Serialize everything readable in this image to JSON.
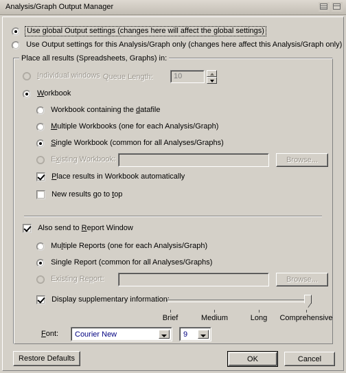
{
  "window": {
    "title": "Analysis/Graph Output Manager",
    "titlebar_buttons": [
      {
        "name": "tile-windows-icon",
        "icon": "tile-icon"
      },
      {
        "name": "cascade-windows-icon",
        "icon": "cascade-icon"
      }
    ]
  },
  "scope": {
    "global_option": "Use global Output settings (changes here will affect the global settings)",
    "local_option": "Use Output settings for this Analysis/Graph only (changes here affect this Analysis/Graph only)",
    "selected": "global"
  },
  "place_group": {
    "title": "Place all results (Spreadsheets, Graphs) in:",
    "individual_windows": "Individual windows",
    "queue_length_label": "Queue Length:",
    "queue_length_value": "10",
    "workbook": "Workbook",
    "workbook_containing_datafile": "Workbook containing the datafile",
    "multiple_workbooks": "Multiple Workbooks (one for each Analysis/Graph)",
    "single_workbook": "Single Workbook (common for all Analyses/Graphs)",
    "existing_workbook": "Existing Workbook:",
    "existing_workbook_value": "",
    "browse_workbook": "Browse...",
    "place_results_auto": "Place results in Workbook automatically",
    "new_results_top": "New results go to top",
    "also_send_report": "Also send to Report Window",
    "multiple_reports": "Multiple Reports (one for each Analysis/Graph)",
    "single_report": "Single Report (common for all Analyses/Graphs)",
    "existing_report": "Existing Report:",
    "existing_report_value": "",
    "browse_report": "Browse...",
    "display_supplementary": "Display supplementary information:"
  },
  "slider": {
    "ticks": [
      "Brief",
      "Medium",
      "Long",
      "Comprehensive"
    ],
    "value": "Comprehensive",
    "position_percent": 100
  },
  "font": {
    "label": "Font:",
    "family_value": "Courier New",
    "size_value": "9"
  },
  "footer": {
    "restore_defaults": "Restore Defaults",
    "ok": "OK",
    "cancel": "Cancel"
  }
}
